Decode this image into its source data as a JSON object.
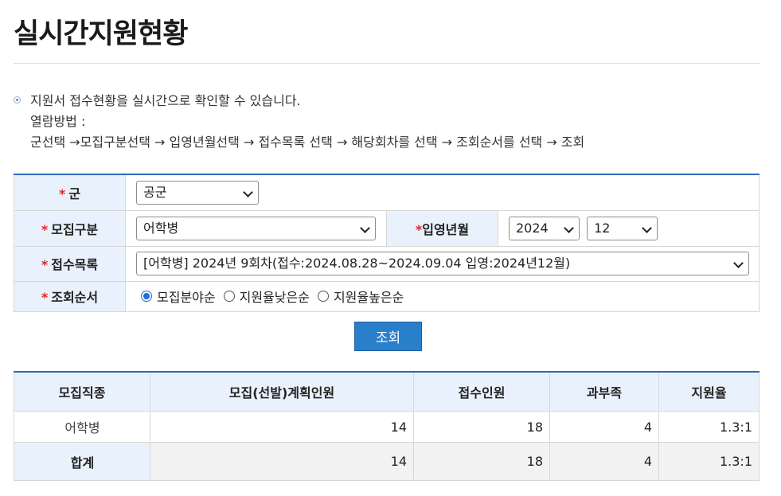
{
  "page": {
    "title": "실시간지원현황"
  },
  "guide": {
    "lines": [
      "지원서 접수현황을 실시간으로 확인할 수 있습니다.",
      "열람방법 :",
      "군선택 →모집구분선택 → 입영년월선택 → 접수목록 선택 → 해당회차를 선택 → 조회순서를 선택 → 조회"
    ]
  },
  "search": {
    "required_mark": "*",
    "branch": {
      "label": "군",
      "value": "공군"
    },
    "category": {
      "label": "모집구분",
      "value": "어학병"
    },
    "enlist": {
      "label": "입영년월",
      "year": "2024",
      "month": "12"
    },
    "list": {
      "label": "접수목록",
      "value": "[어학병] 2024년 9회차(접수:2024.08.28~2024.09.04 입영:2024년12월)"
    },
    "order": {
      "label": "조회순서",
      "options": [
        "모집분야순",
        "지원율낮은순",
        "지원율높은순"
      ],
      "selected": "모집분야순"
    },
    "submit_label": "조회"
  },
  "results": {
    "headers": [
      "모집직종",
      "모집(선발)계획인원",
      "접수인원",
      "과부족",
      "지원율"
    ],
    "rows": [
      {
        "field": "어학병",
        "plan": "14",
        "applied": "18",
        "diff": "4",
        "rate": "1.3:1"
      }
    ],
    "total": {
      "field": "합계",
      "plan": "14",
      "applied": "18",
      "diff": "4",
      "rate": "1.3:1"
    }
  },
  "colors": {
    "accent": "#2e6bb8",
    "button": "#2a7fcb",
    "header_bg": "#e9f2fc",
    "required": "#e0262b"
  }
}
